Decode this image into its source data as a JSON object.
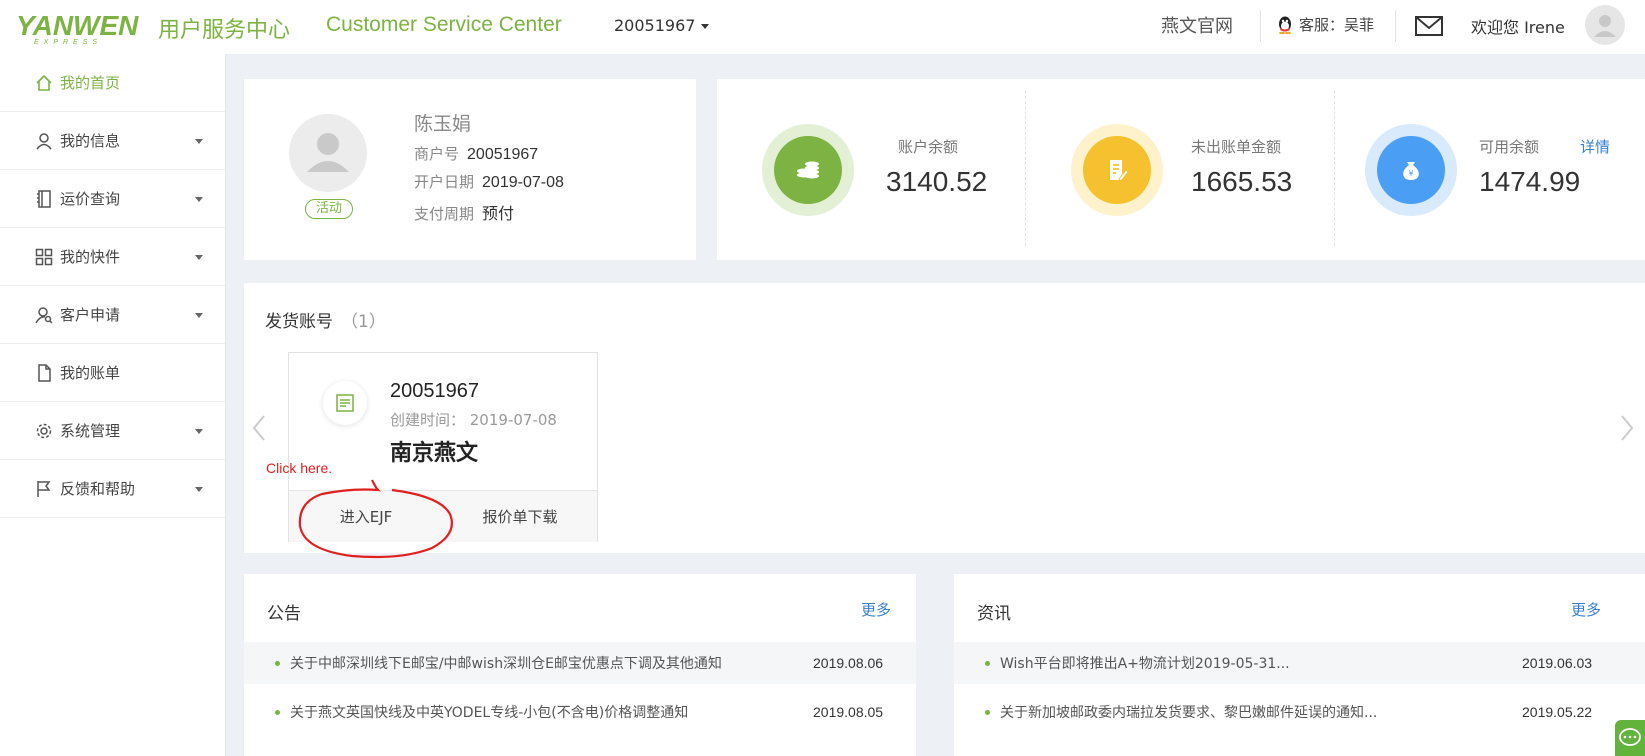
{
  "header": {
    "logo_text": "YANWEN",
    "brand_cn": "用户服务中心",
    "brand_en": "Customer Service Center",
    "account_dropdown": "20051967",
    "official_site": "燕文官网",
    "service_label": "客服：吴菲",
    "welcome": "欢迎您 Irene",
    "accent_color": "#7cb342"
  },
  "sidebar": {
    "items": [
      {
        "label": "我的首页",
        "icon": "home-icon"
      },
      {
        "label": "我的信息",
        "icon": "user-icon"
      },
      {
        "label": "运价查询",
        "icon": "book-icon"
      },
      {
        "label": "我的快件",
        "icon": "grid-icon"
      },
      {
        "label": "客户申请",
        "icon": "user-search-icon"
      },
      {
        "label": "我的账单",
        "icon": "file-icon"
      },
      {
        "label": "系统管理",
        "icon": "gear-icon"
      },
      {
        "label": "反馈和帮助",
        "icon": "flag-icon"
      }
    ]
  },
  "profile": {
    "name": "陈玉娟",
    "status": "活动",
    "merchant_label": "商户号",
    "merchant_value": "20051967",
    "open_date_label": "开户日期",
    "open_date_value": "2019-07-08",
    "pay_cycle_label": "支付周期",
    "pay_cycle_value": "预付"
  },
  "balances": [
    {
      "label": "账户余额",
      "value": "3140.52",
      "color": "#7cb342"
    },
    {
      "label": "未出账单金额",
      "value": "1665.53",
      "color": "#f5c12e"
    },
    {
      "label": "可用余额",
      "value": "1474.99",
      "color": "#4a9ff5"
    }
  ],
  "balance_detail": "详情",
  "shipping": {
    "title": "发货账号",
    "count": "（1）",
    "card": {
      "number": "20051967",
      "created": "创建时间： 2019-07-08",
      "name": "南京燕文",
      "enter_label": "进入EJF",
      "download_label": "报价单下载"
    },
    "annotation": "Click here."
  },
  "notices": {
    "title": "公告",
    "more": "更多",
    "rows": [
      {
        "text": "关于中邮深圳线下E邮宝/中邮wish深圳仓E邮宝优惠点下调及其他通知",
        "date": "2019.08.06"
      },
      {
        "text": "关于燕文英国快线及中英YODEL专线-小包(不含电)价格调整通知",
        "date": "2019.08.05"
      }
    ]
  },
  "news": {
    "title": "资讯",
    "more": "更多",
    "rows": [
      {
        "text": "Wish平台即将推出A+物流计划2019-05-31...",
        "date": "2019.06.03"
      },
      {
        "text": "关于新加坡邮政委内瑞拉发货要求、黎巴嫩邮件延误的通知...",
        "date": "2019.05.22"
      }
    ]
  }
}
